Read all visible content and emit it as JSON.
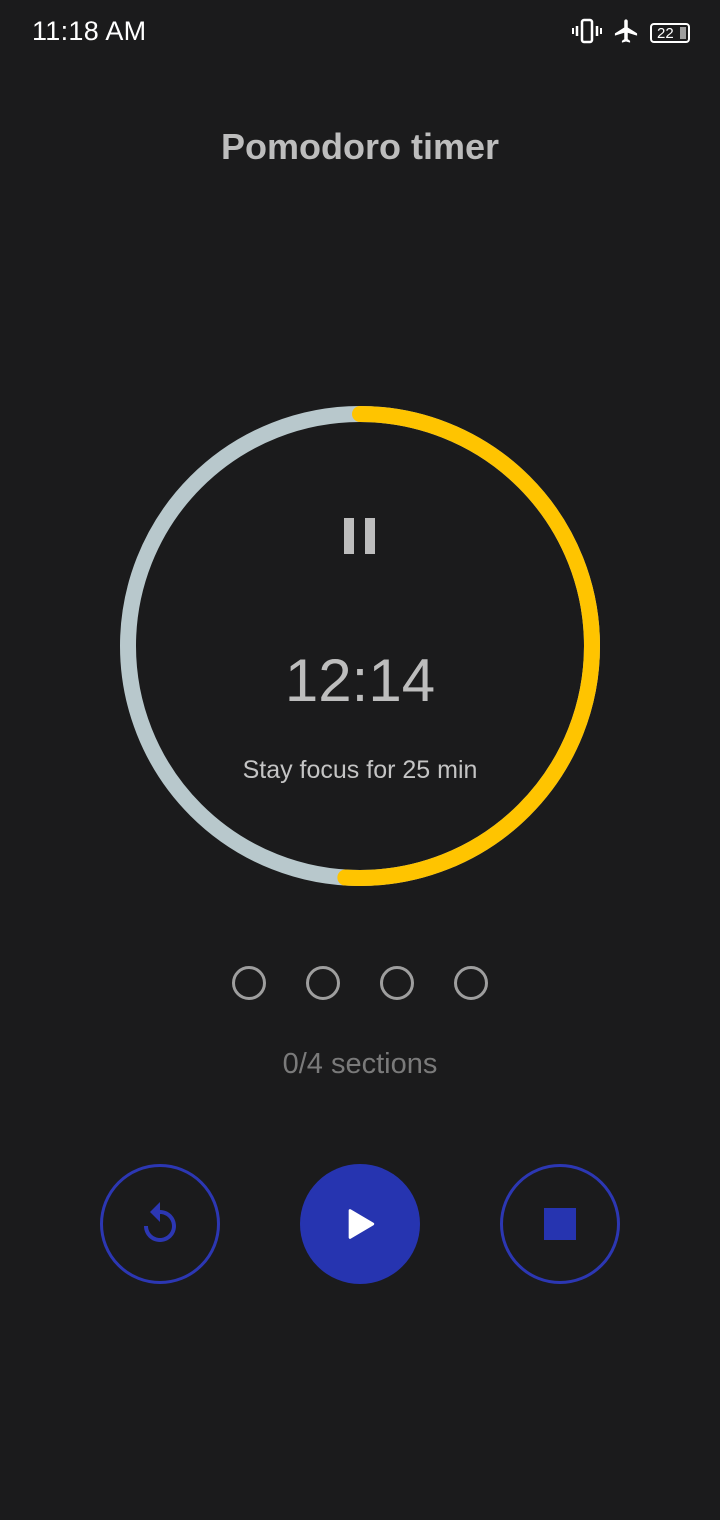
{
  "status_bar": {
    "time": "11:18 AM",
    "battery_level": "22",
    "icons": [
      "vibrate-icon",
      "airplane-mode-icon",
      "battery-icon"
    ]
  },
  "app": {
    "title": "Pomodoro timer"
  },
  "timer": {
    "remaining": "12:14",
    "caption": "Stay focus for 25 min",
    "progress_fraction": 0.51,
    "colors": {
      "progress": "#ffc400",
      "track": "#b8c8cc"
    }
  },
  "sessions": {
    "completed": 0,
    "total": 4,
    "label": "0/4 sections"
  },
  "controls": {
    "reset_icon": "replay-icon",
    "play_icon": "play-icon",
    "stop_icon": "stop-icon",
    "accent": "#2634b0"
  }
}
